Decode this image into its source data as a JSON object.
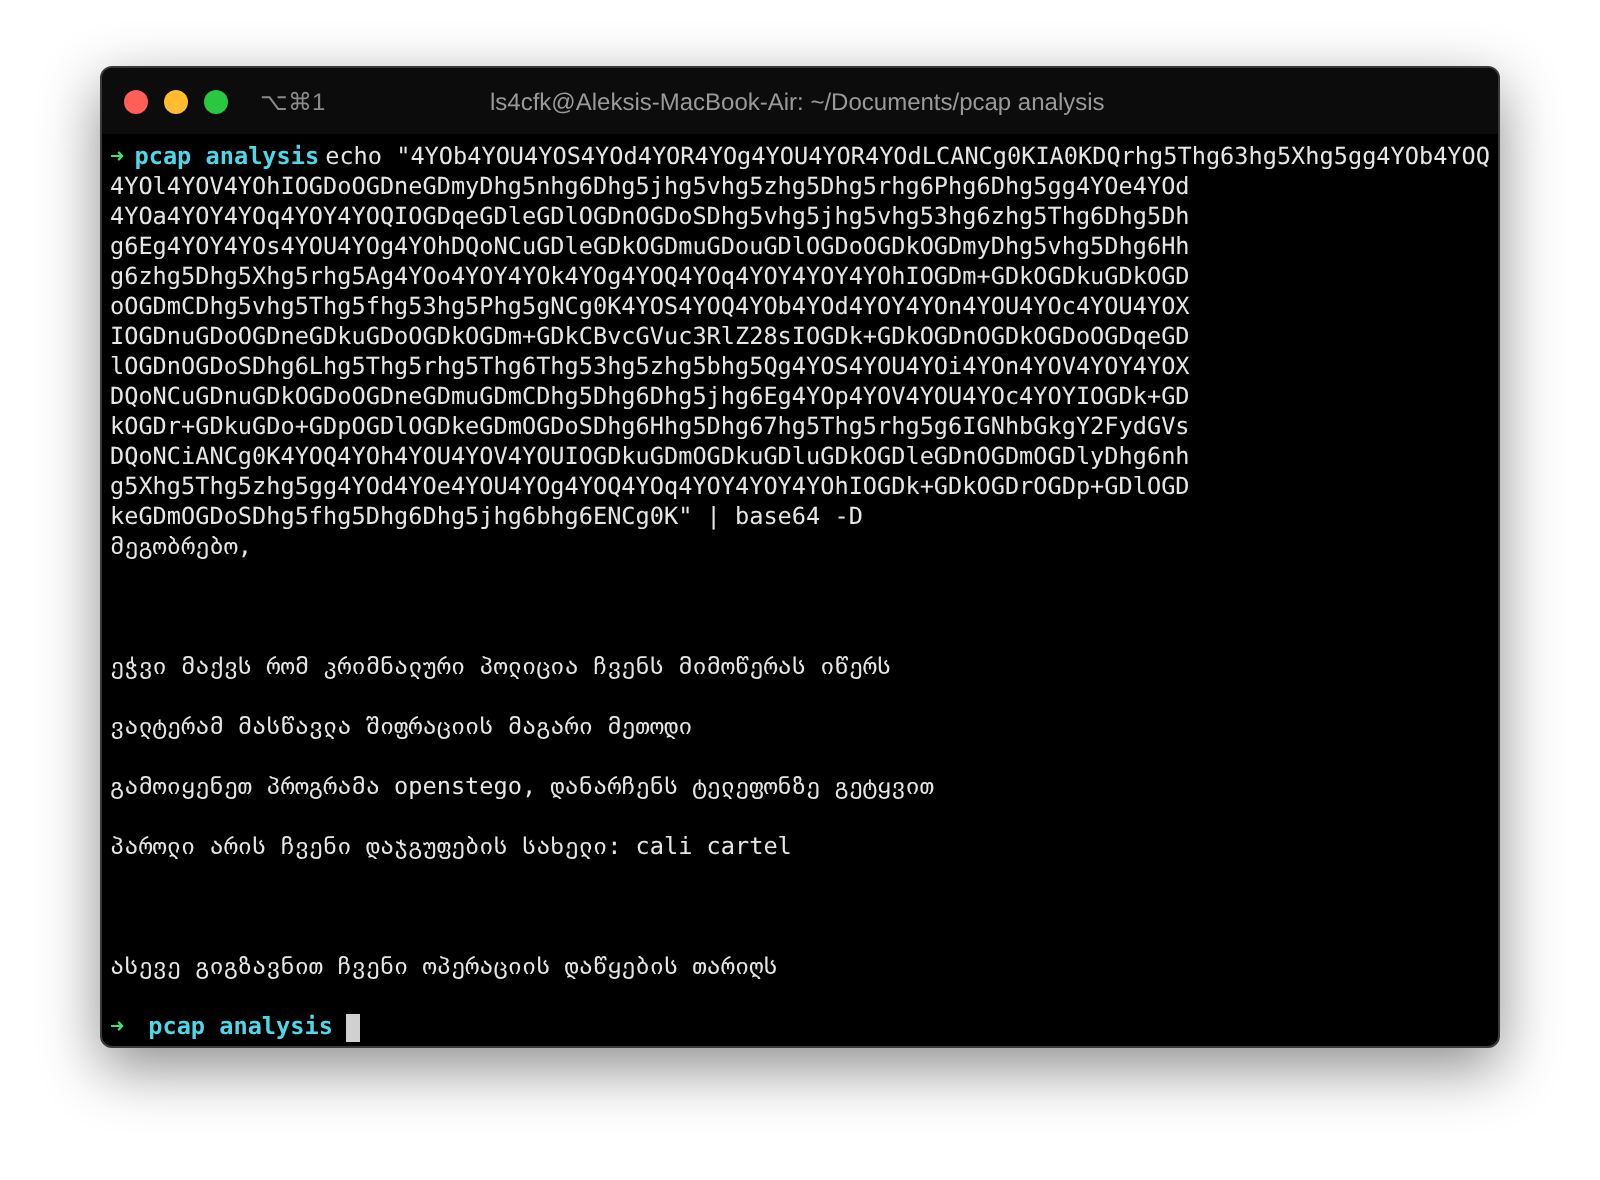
{
  "window": {
    "shortcut": "⌥⌘1",
    "title": "ls4cfk@Aleksis-MacBook-Air: ~/Documents/pcap analysis"
  },
  "command": {
    "prompt_arrow": "➜",
    "directory": "pcap analysis",
    "lines": [
      "echo \"4YOb4YOU4YOS4YOd4YOR4YOg4YOU4YOR4YOdLCANCg0KIA0KDQrhg5Thg63hg5Xhg5gg4YOb4YOQ",
      "4YOl4YOV4YOhIOGDoOGDneGDmyDhg5nhg6Dhg5jhg5vhg5zhg5Dhg5rhg6Phg6Dhg5gg4YOe4YOd",
      "4YOa4YOY4YOq4YOY4YOQIOGDqeGDleGDlOGDnOGDoSDhg5vhg5jhg5vhg53hg6zhg5Thg6Dhg5Dh",
      "g6Eg4YOY4YOs4YOU4YOg4YOhDQoNCuGDleGDkOGDmuGDouGDlOGDoOGDkOGDmyDhg5vhg5Dhg6Hh",
      "g6zhg5Dhg5Xhg5rhg5Ag4YOo4YOY4YOk4YOg4YOQ4YOq4YOY4YOY4YOhIOGDm+GDkOGDkuGDkOGD",
      "oOGDmCDhg5vhg5Thg5fhg53hg5Phg5gNCg0K4YOS4YOQ4YOb4YOd4YOY4YOn4YOU4YOc4YOU4YOX",
      "IOGDnuGDoOGDneGDkuGDoOGDkOGDm+GDkCBvcGVuc3RlZ28sIOGDk+GDkOGDnOGDkOGDoOGDqeGD",
      "lOGDnOGDoSDhg6Lhg5Thg5rhg5Thg6Thg53hg5zhg5bhg5Qg4YOS4YOU4YOi4YOn4YOV4YOY4YOX",
      "DQoNCuGDnuGDkOGDoOGDneGDmuGDmCDhg5Dhg6Dhg5jhg6Eg4YOp4YOV4YOU4YOc4YOYIOGDk+GD",
      "kOGDr+GDkuGDo+GDpOGDlOGDkeGDmOGDoSDhg6Hhg5Dhg67hg5Thg5rhg5g6IGNhbGkgY2FydGVs",
      "DQoNCiANCg0K4YOQ4YOh4YOU4YOV4YOUIOGDkuGDmOGDkuGDluGDkOGDleGDnOGDmOGDlyDhg6nh",
      "g5Xhg5Thg5zhg5gg4YOd4YOe4YOU4YOg4YOQ4YOq4YOY4YOY4YOhIOGDk+GDkOGDrOGDp+GDlOGD",
      "keGDmOGDoSDhg5fhg5Dhg6Dhg5jhg6bhg6ENCg0K\" | base64 -D"
    ]
  },
  "output": [
    "მეგობრებო,",
    "ეჭვი მაქვს რომ კრიმნალური პოლიცია ჩვენს მიმოწერას იწერს",
    "ვალტერამ მასწავლა შიფრაციის მაგარი მეთოდი",
    "გამოიყენეთ პროგრამა openstego, დანარჩენს ტელეფონზე გეტყვით",
    "პაროლი არის ჩვენი დაჯგუფების სახელი: cali cartel",
    "ასევე გიგზავნით ჩვენი ოპერაციის დაწყების თარიღს"
  ],
  "prompt": {
    "prompt_arrow": "➜",
    "directory": "pcap analysis"
  }
}
